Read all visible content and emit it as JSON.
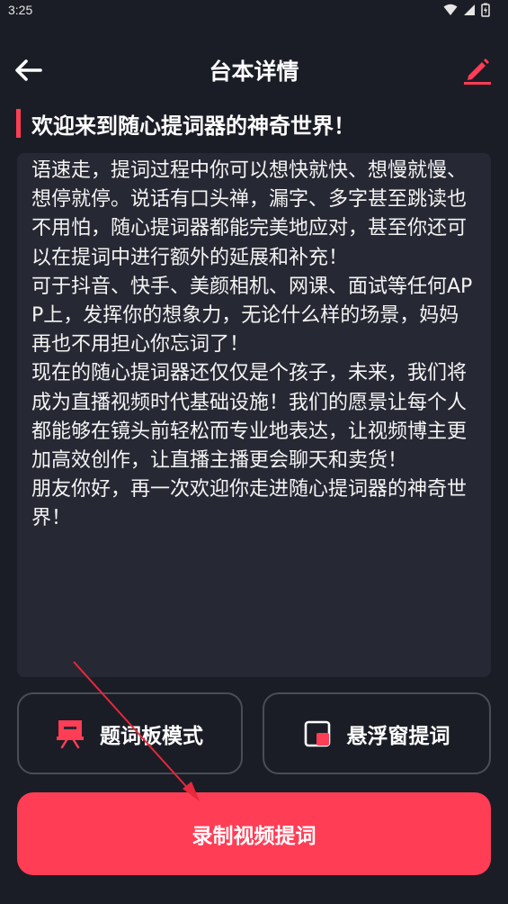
{
  "status_bar": {
    "time": "3:25"
  },
  "app_bar": {
    "title": "台本详情",
    "back_icon": "arrow-left-icon",
    "edit_icon": "pencil-icon"
  },
  "script": {
    "title": "欢迎来到随心提词器的神奇世界！",
    "body": "语速走，提词过程中你可以想快就快、想慢就慢、想停就停。说话有口头禅，漏字、多字甚至跳读也不用怕，随心提词器都能完美地应对，甚至你还可以在提词中进行额外的延展和补充！\n可于抖音、快手、美颜相机、网课、面试等任何APP上，发挥你的想象力，无论什么样的场景，妈妈再也不用担心你忘词了！\n现在的随心提词器还仅仅是个孩子，未来，我们将成为直播视频时代基础设施！我们的愿景让每个人都能够在镜头前轻松而专业地表达，让视频博主更加高效创作，让直播主播更会聊天和卖货！\n朋友你好，再一次欢迎你走进随心提词器的神奇世界！"
  },
  "buttons": {
    "teleprompter_board": "题词板模式",
    "floating_window": "悬浮窗提词",
    "record_video": "录制视频提词"
  },
  "colors": {
    "background": "#1b1d26",
    "card": "#262833",
    "accent": "#ff3d55",
    "border": "#4a4c57"
  }
}
